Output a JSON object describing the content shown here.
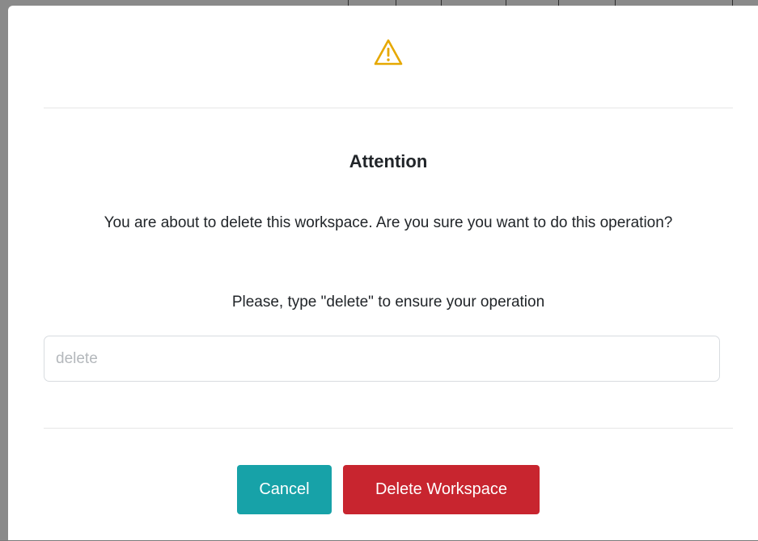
{
  "dialog": {
    "icon": "warning-triangle-icon",
    "icon_color": "#e6a800",
    "title": "Attention",
    "message": "You are about to delete this workspace. Are you sure you want to do this operation?",
    "hint": "Please, type \"delete\" to ensure your operation",
    "input": {
      "value": "",
      "placeholder": "delete"
    },
    "buttons": {
      "cancel_label": "Cancel",
      "delete_label": "Delete Workspace"
    },
    "colors": {
      "cancel": "#17a2a8",
      "delete": "#c8252f"
    }
  }
}
